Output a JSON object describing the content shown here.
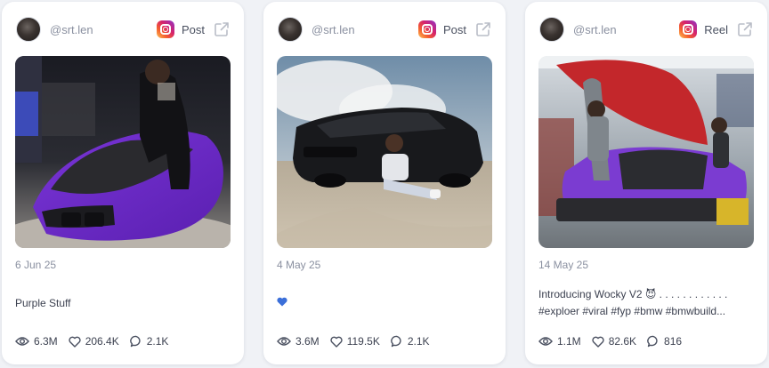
{
  "accent": {
    "instagram_gradient": [
      "#fdc35a",
      "#f5602e",
      "#d6236b",
      "#8e34c9"
    ],
    "heart": "#3b6fd9"
  },
  "cards": [
    {
      "handle": "@srt.len",
      "type": "Post",
      "date": "6 Jun 25",
      "caption_lines": [
        "Purple Stuff"
      ],
      "stats": {
        "views": "6.3M",
        "likes": "206.4K",
        "comments": "2.1K"
      }
    },
    {
      "handle": "@srt.len",
      "type": "Post",
      "date": "4 May 25",
      "caption_emoji": "blue-heart",
      "stats": {
        "views": "3.6M",
        "likes": "119.5K",
        "comments": "2.1K"
      }
    },
    {
      "handle": "@srt.len",
      "type": "Reel",
      "date": "14 May 25",
      "caption_lines": [
        "Introducing Wocky V2 😈 . . . . . . . . . . . .",
        "#exploer #viral #fyp #bmw #bmwbuild..."
      ],
      "stats": {
        "views": "1.1M",
        "likes": "82.6K",
        "comments": "816"
      }
    }
  ]
}
